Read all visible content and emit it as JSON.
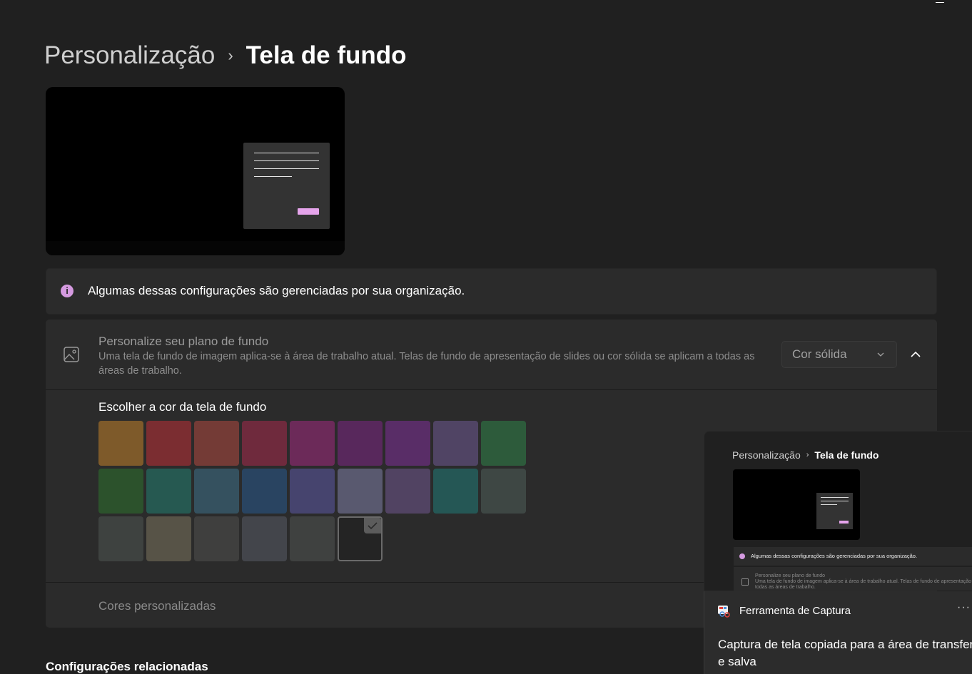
{
  "breadcrumb": {
    "parent": "Personalização",
    "separator": "›",
    "current": "Tela de fundo"
  },
  "info_bar": {
    "text": "Algumas dessas configurações são gerenciadas por sua organização."
  },
  "background_setting": {
    "title": "Personalize seu plano de fundo",
    "description": "Uma tela de fundo de imagem aplica-se à área de trabalho atual. Telas de fundo de apresentação de slides ou cor sólida se aplicam a todas as áreas de trabalho.",
    "dropdown_value": "Cor sólida"
  },
  "palette": {
    "title": "Escolher a cor da tela de fundo",
    "colors": [
      "#ba7c2a",
      "#b52f35",
      "#a8463e",
      "#a02a4a",
      "#9b2a7a",
      "#782680",
      "#7a2f92",
      "#6a568e",
      "#2e7e46",
      "#2d6f2d",
      "#227a6c",
      "#3c6d84",
      "#275688",
      "#5a569f",
      "#7a7aa0",
      "#6d558a",
      "#207773",
      "#4b5c57",
      "#4b524f",
      "#77705c",
      "#4d4d4b",
      "#545863",
      "#4d5150",
      "#242424"
    ],
    "selected_index": 23,
    "custom_colors_label": "Cores personalizadas"
  },
  "related_settings": "Configurações relacionadas",
  "snip_thumbnail": {
    "breadcrumb_parent": "Personalização",
    "breadcrumb_current": "Tela de fundo",
    "info_text": "Algumas dessas configurações são gerenciadas por sua organização.",
    "panel_title": "Personalize seu plano de fundo",
    "panel_desc_1": "Uma tela de fundo de imagem aplica-se à área de trabalho atual. Telas de fundo de apresentação de slides",
    "panel_desc_2": "todas as áreas de trabalho."
  },
  "toast": {
    "app_name": "Ferramenta de Captura",
    "more": "···",
    "message_line1": "Captura de tela copiada para a área de transferência",
    "message_line2": "e salva"
  },
  "accent_color": "#d59ae0"
}
